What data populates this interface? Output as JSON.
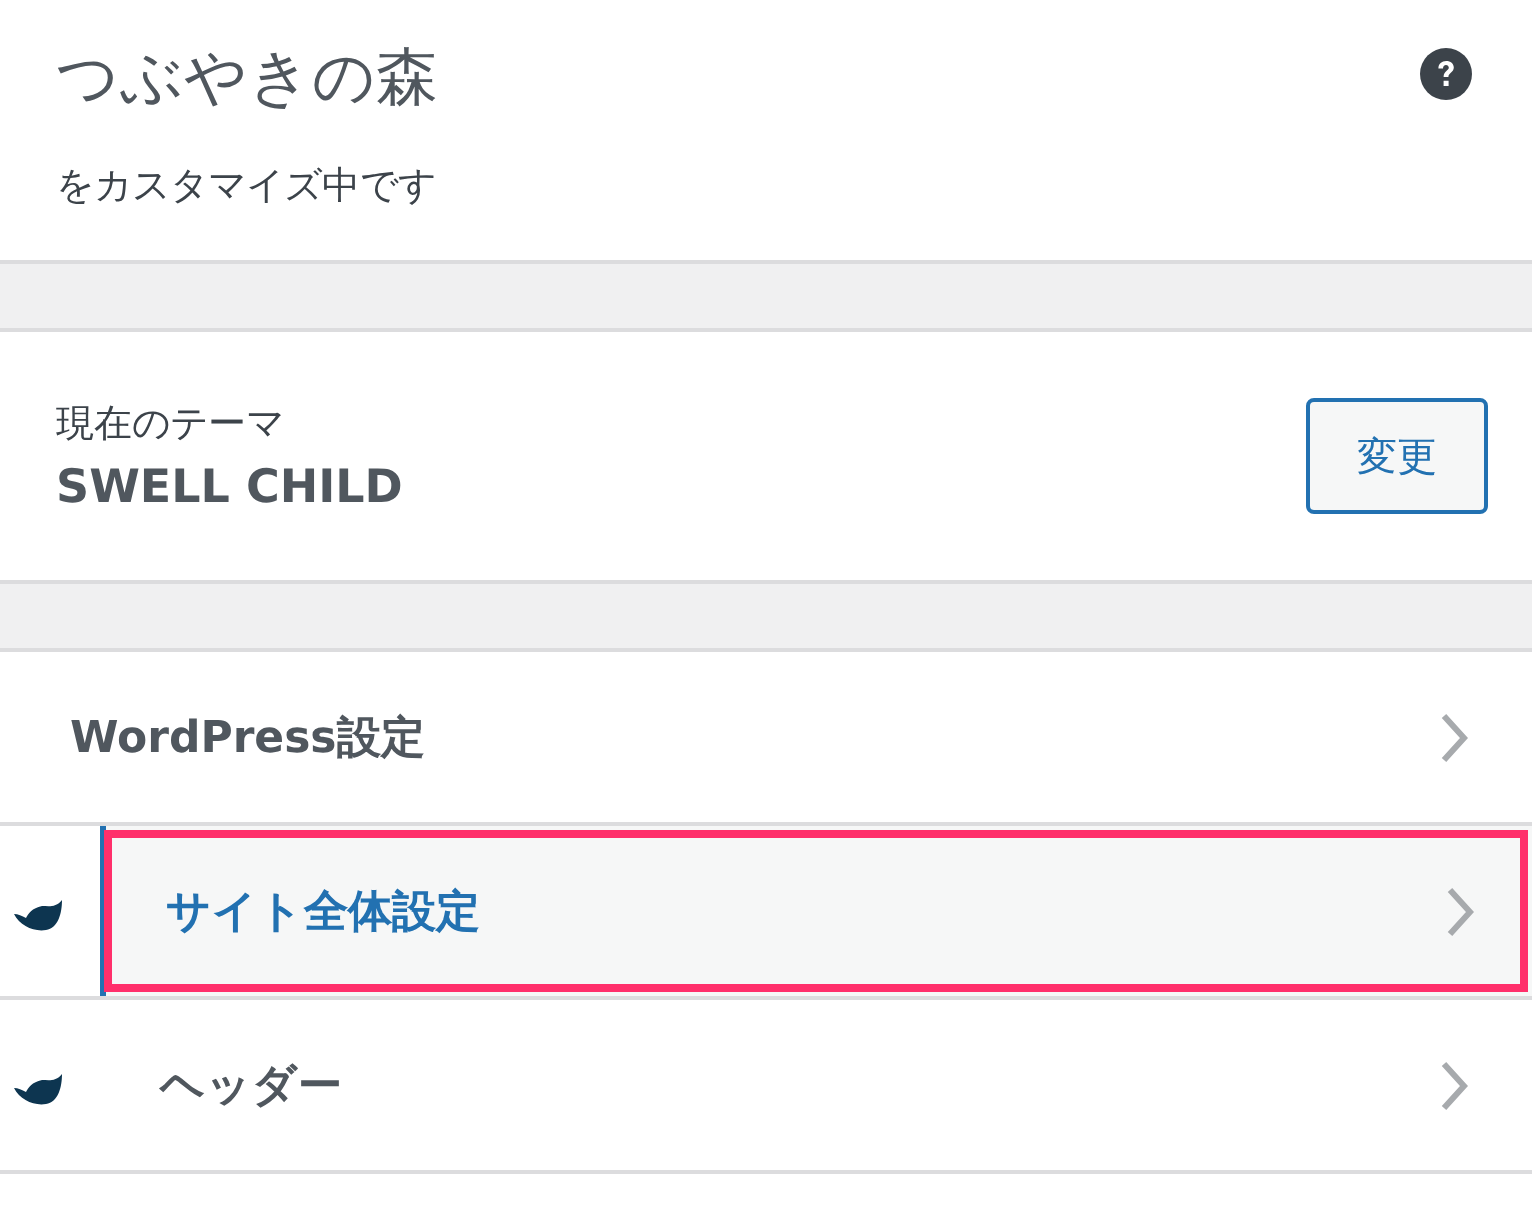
{
  "header": {
    "site_title": "つぶやきの森",
    "subtitle": "をカスタマイズ中です"
  },
  "theme": {
    "label": "現在のテーマ",
    "name": "SWELL CHILD",
    "button": "変更"
  },
  "sections": [
    {
      "label": "WordPress設定",
      "icon": false,
      "selected": false
    },
    {
      "label": "サイト全体設定",
      "icon": true,
      "selected": true
    },
    {
      "label": "ヘッダー",
      "icon": true,
      "selected": false
    }
  ]
}
